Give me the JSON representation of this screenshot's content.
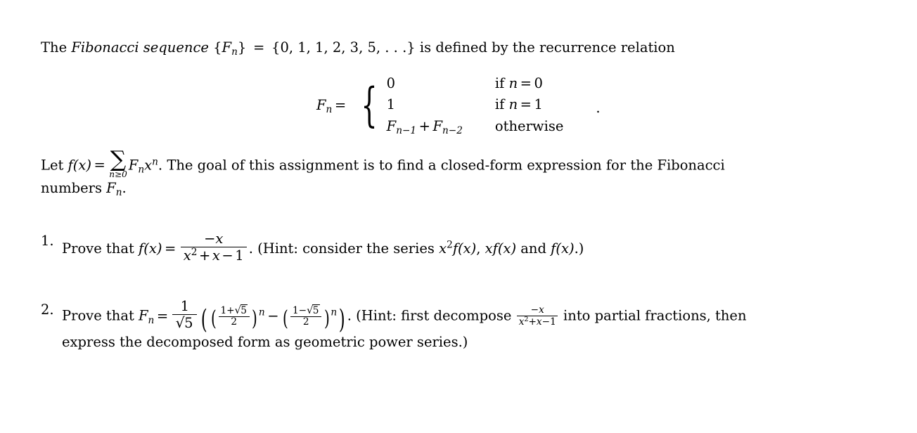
{
  "document": {
    "intro": {
      "lead": "The",
      "emph": "Fibonacci sequence",
      "seq_open": "{",
      "seq_symbol": "F",
      "seq_sub": "n",
      "seq_close": "}",
      "equals": "=",
      "seq_values": "{0, 1, 1, 2, 3, 5, . . .}",
      "tail": "is defined by the recurrence relation"
    },
    "recurrence": {
      "lhs_symbol": "F",
      "lhs_sub": "n",
      "equals": "=",
      "brace": "{",
      "cases": [
        {
          "value": "0",
          "condition_prefix": "if",
          "condition_var": "n",
          "condition_rel": "=",
          "condition_val": "0"
        },
        {
          "value": "1",
          "condition_prefix": "if",
          "condition_var": "n",
          "condition_rel": "=",
          "condition_val": "1"
        },
        {
          "value_sym_a": "F",
          "value_sub_a": "n−1",
          "value_op": "+",
          "value_sym_b": "F",
          "value_sub_b": "n−2",
          "condition_prefix": "otherwise"
        }
      ],
      "period": "."
    },
    "generating": {
      "let": "Let",
      "f": "f",
      "of_x": "(x)",
      "equals": "=",
      "sigma": "∑",
      "limit": "n≥0",
      "term_F": "F",
      "term_sub": "n",
      "term_x": "x",
      "term_sup": "n",
      "period": ".",
      "sentence": "The goal of this assignment is to find a closed-form expression for the Fibonacci",
      "sentence_tail_prefix": "numbers",
      "sentence_tail_F": "F",
      "sentence_tail_sub": "n",
      "sentence_tail_period": "."
    },
    "problems": [
      {
        "marker": "1.",
        "lead": "Prove that",
        "f": "f",
        "of_x": "(x)",
        "equals": "=",
        "fraction": {
          "numerator": "−x",
          "denominator_x": "x",
          "denominator_sup": "2",
          "denominator_plus": "+",
          "denominator_x2": "x",
          "denominator_minus": "−",
          "denominator_one": "1"
        },
        "period": ".",
        "hint_open": "(Hint: consider the series",
        "hint_term1_x": "x",
        "hint_term1_sup": "2",
        "hint_term1_f": "f(x)",
        "hint_comma": ",",
        "hint_term2": "xf(x)",
        "hint_and": "and",
        "hint_term3": "f(x)",
        "hint_close": ".)"
      },
      {
        "marker": "2.",
        "lead": "Prove that",
        "F": "F",
        "F_sub": "n",
        "equals": "=",
        "coefficient": {
          "numerator": "1",
          "denominator_radical": "√",
          "denominator_radicand": "5"
        },
        "outer_open": "(",
        "phi_open": "(",
        "phi_num_one": "1",
        "phi_num_plus": "+",
        "phi_num_radical": "√",
        "phi_num_radicand": "5",
        "phi_den": "2",
        "phi_close": ")",
        "phi_exp": "n",
        "minus": "−",
        "psi_open": "(",
        "psi_num_one": "1",
        "psi_num_minus": "−",
        "psi_num_radical": "√",
        "psi_num_radicand": "5",
        "psi_den": "2",
        "psi_close": ")",
        "psi_exp": "n",
        "outer_close": ")",
        "period": ".",
        "hint_open": "(Hint: first decompose",
        "hint_fraction": {
          "numerator": "−x",
          "denominator_x": "x",
          "denominator_sup": "2",
          "denominator_plus": "+",
          "denominator_x2": "x",
          "denominator_minus": "−",
          "denominator_one": "1"
        },
        "hint_mid": "into partial fractions, then",
        "hint_tail": "express the decomposed form as geometric power series.)"
      }
    ]
  },
  "style": {
    "background_color": "#ffffff",
    "text_color": "#000000"
  }
}
